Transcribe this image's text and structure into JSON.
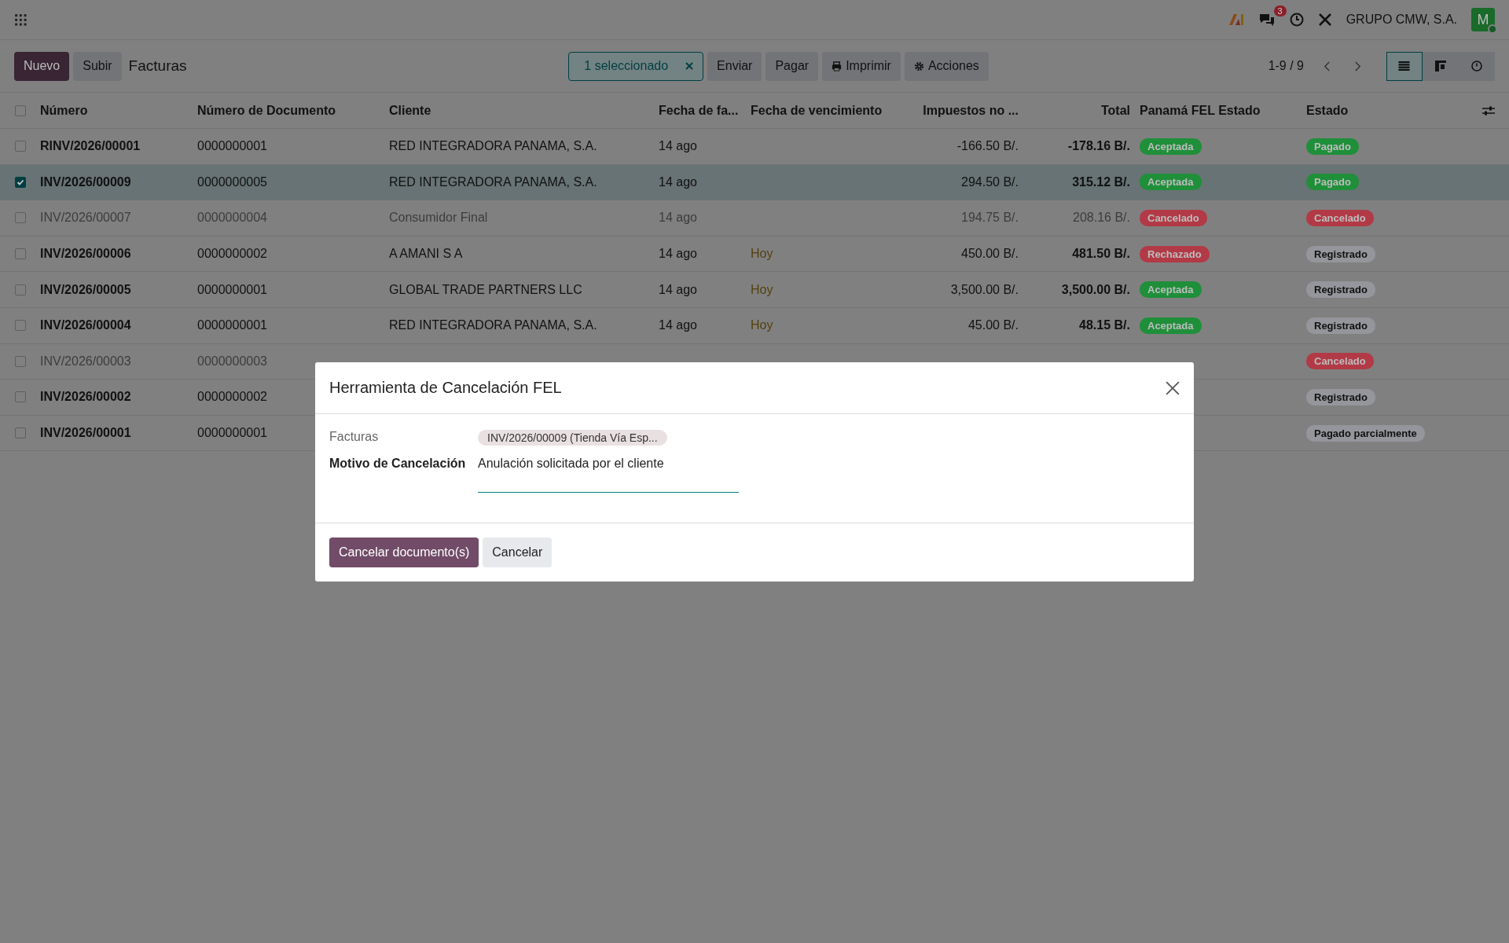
{
  "top_bar": {
    "company": "GRUPO CMW, S.A.",
    "avatar": "M",
    "messages_count": "3"
  },
  "control_panel": {
    "buttons": [
      "Nuevo",
      "Subir"
    ],
    "title": "Facturas",
    "selection": "1 seleccionado",
    "actions": [
      "Enviar",
      "Pagar",
      "Imprimir",
      "Acciones"
    ],
    "pager": "1-9 / 9"
  },
  "views": [
    {
      "kind": "list",
      "selected": true
    },
    {
      "kind": "kanban",
      "selected": false
    },
    {
      "kind": "activity",
      "selected": false
    }
  ],
  "table": {
    "all_selected": false,
    "columns": [
      "Número",
      "Número de Documento",
      "Cliente",
      "Fecha de fa...",
      "Fecha de vencimiento",
      "Impuestos no ...",
      "Total",
      "Panamá FEL Estado",
      "Estado"
    ],
    "rows": [
      {
        "number": "RINV/2026/00001",
        "document": "0000000001",
        "client": "RED INTEGRADORA PANAMA, S.A.",
        "date": "14 ago",
        "tax": "-166.50 B/.",
        "total": "-178.16 B/.",
        "fel": {
          "text": "Aceptada",
          "color": "#1f8f3a"
        },
        "status": {
          "text": "Pagado",
          "color": "#1f8f3a"
        },
        "selected": false,
        "cancelled": false
      },
      {
        "number": "INV/2026/00009",
        "document": "0000000005",
        "client": "RED INTEGRADORA PANAMA, S.A.",
        "date": "14 ago",
        "tax": "294.50 B/.",
        "total": "315.12 B/.",
        "fel": {
          "text": "Aceptada",
          "color": "#1f8f3a"
        },
        "status": {
          "text": "Pagado",
          "color": "#1f8f3a"
        },
        "selected": true,
        "cancelled": false
      },
      {
        "number": "INV/2026/00007",
        "document": "0000000004",
        "client": "Consumidor Final",
        "date": "14 ago",
        "tax": "194.75 B/.",
        "total": "208.16 B/.",
        "fel": {
          "text": "Cancelado",
          "color": "#b23a46"
        },
        "status": {
          "text": "Cancelado",
          "color": "#b23a46"
        },
        "selected": false,
        "cancelled": true
      },
      {
        "number": "INV/2026/00006",
        "document": "0000000002",
        "client": "A AMANI S A",
        "date": "14 ago",
        "due": "Hoy",
        "tax": "450.00 B/.",
        "total": "481.50 B/.",
        "fel": {
          "text": "Rechazado",
          "color": "#b23a46"
        },
        "status": {
          "text": "Registrado",
          "color": "#94969b"
        },
        "selected": false,
        "cancelled": false
      },
      {
        "number": "INV/2026/00005",
        "document": "0000000001",
        "client": "GLOBAL TRADE PARTNERS LLC",
        "date": "14 ago",
        "due": "Hoy",
        "tax": "3,500.00 B/.",
        "total": "3,500.00 B/.",
        "fel": {
          "text": "Aceptada",
          "color": "#1f8f3a"
        },
        "status": {
          "text": "Registrado",
          "color": "#94969b"
        },
        "selected": false,
        "cancelled": false
      },
      {
        "number": "INV/2026/00004",
        "document": "0000000001",
        "client": "RED INTEGRADORA PANAMA, S.A.",
        "date": "14 ago",
        "due": "Hoy",
        "tax": "45.00 B/.",
        "total": "48.15 B/.",
        "fel": {
          "text": "Aceptada",
          "color": "#1f8f3a"
        },
        "status": {
          "text": "Registrado",
          "color": "#94969b"
        },
        "selected": false,
        "cancelled": false
      },
      {
        "number": "INV/2026/00003",
        "document": "0000000003",
        "status": {
          "text": "Cancelado",
          "color": "#b23a46"
        },
        "selected": false,
        "cancelled": true
      },
      {
        "number": "INV/2026/00002",
        "document": "0000000002",
        "status": {
          "text": "Registrado",
          "color": "#94969b"
        },
        "selected": false,
        "cancelled": false
      },
      {
        "number": "INV/2026/00001",
        "document": "0000000001",
        "status": {
          "text": "Pagado parcialmente",
          "color": "#94969b"
        },
        "selected": false,
        "cancelled": false
      }
    ]
  },
  "dialog": {
    "title": "Herramienta de Cancelación FEL",
    "fields": [
      {
        "label": "Facturas",
        "kind": "tags",
        "value": "INV/2026/00009 (Tienda Vía Esp..."
      },
      {
        "label": "Motivo de Cancelación",
        "kind": "text",
        "value": "Anulación solicitada por el cliente"
      }
    ],
    "buttons": [
      "Cancelar documento(s)",
      "Cancelar"
    ]
  }
}
